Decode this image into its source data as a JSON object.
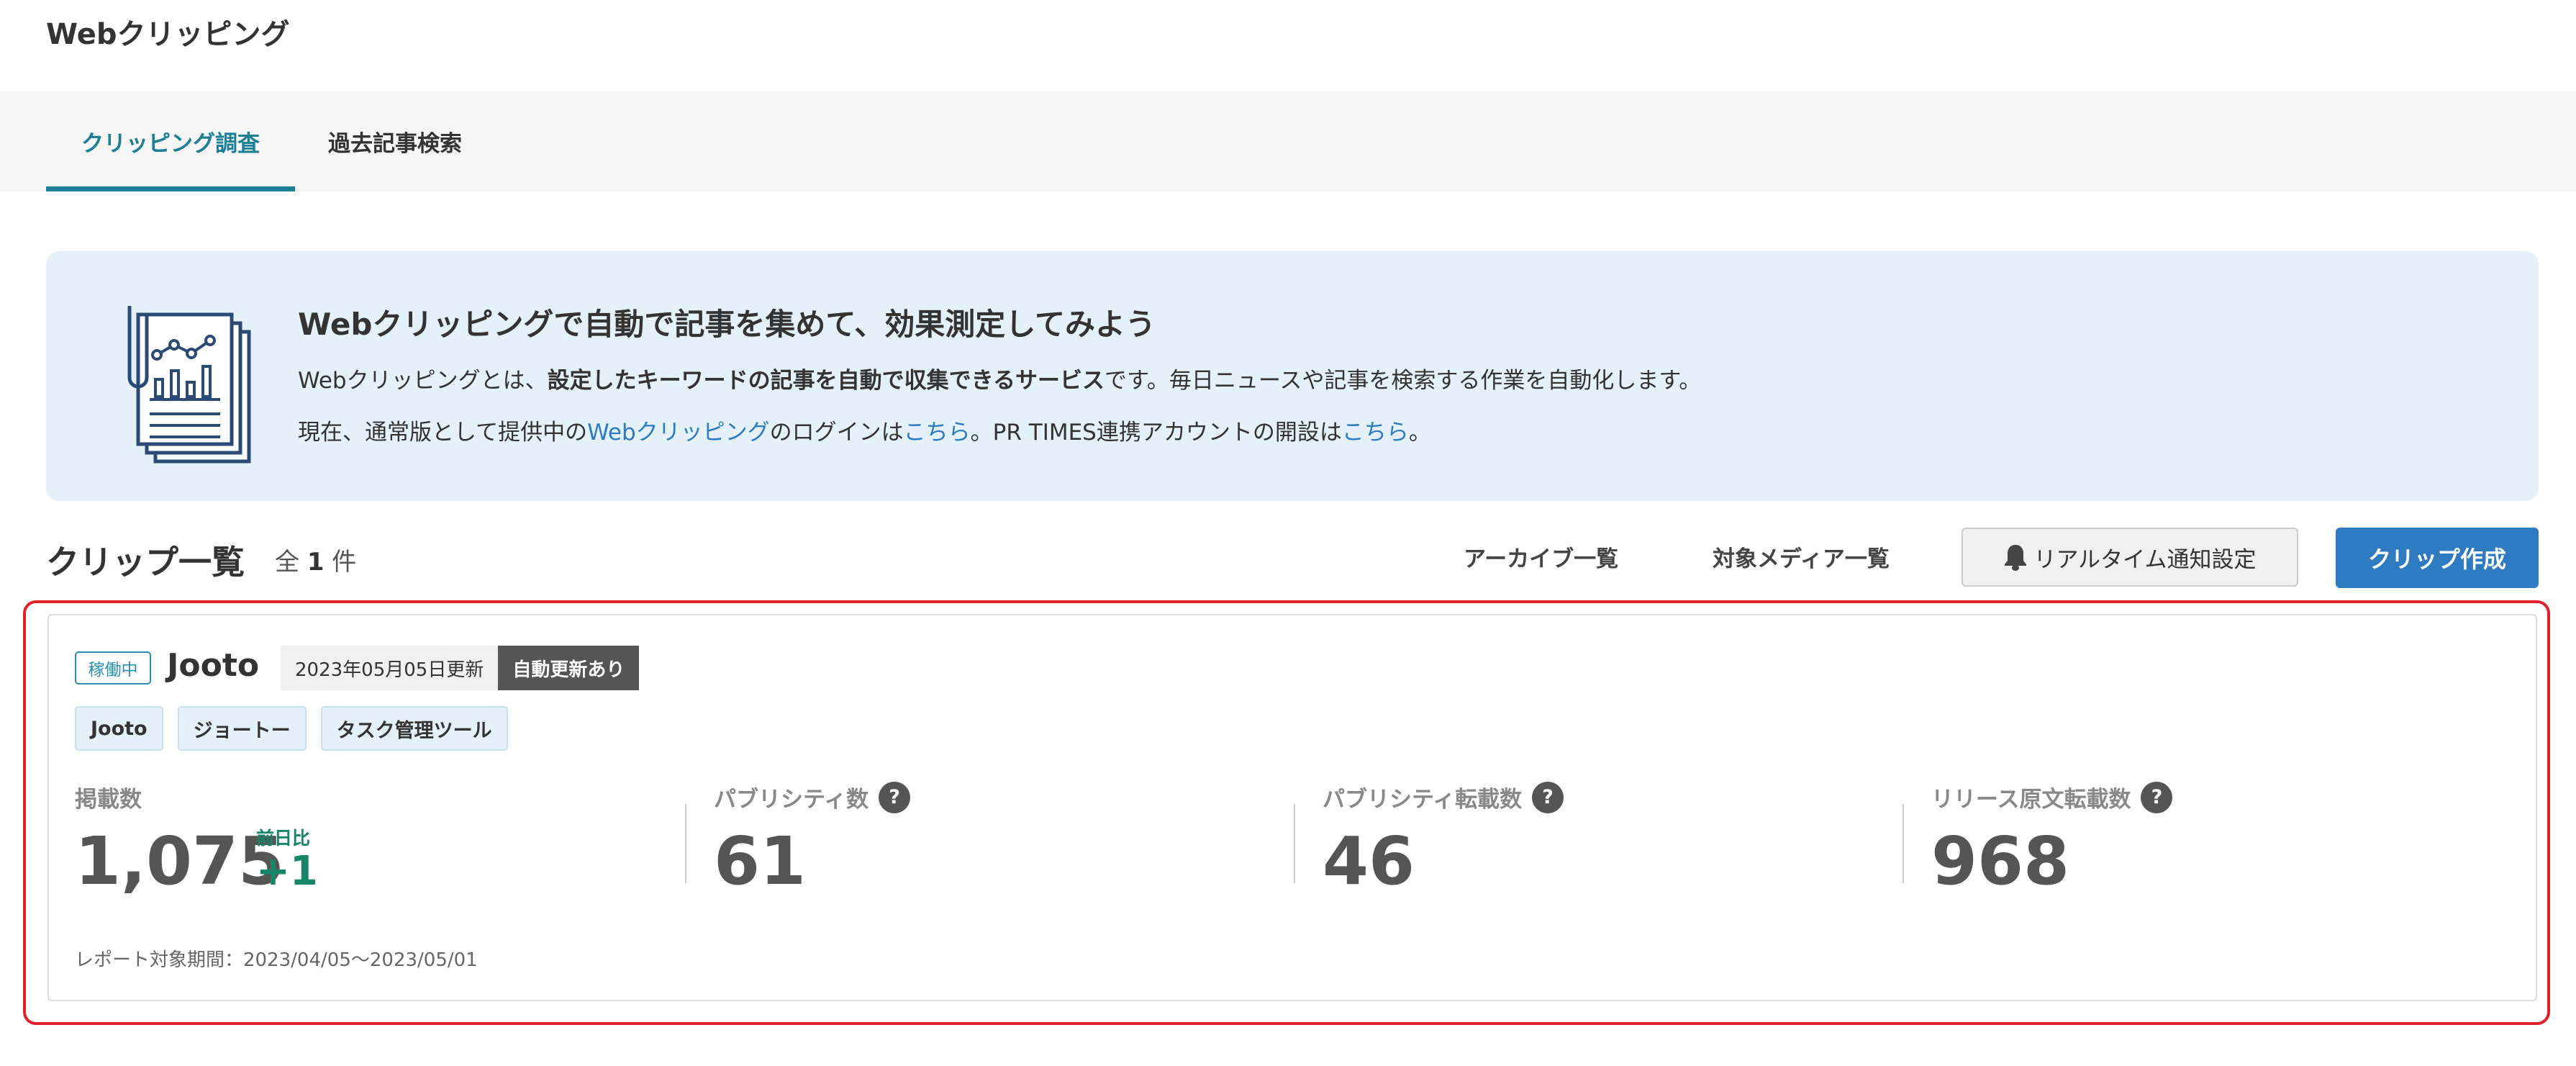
{
  "app": {
    "title": "Webクリッピング"
  },
  "tabs": [
    {
      "label": "クリッピング調査",
      "active": true
    },
    {
      "label": "過去記事検索",
      "active": false
    }
  ],
  "banner": {
    "title": "Webクリッピングで自動で記事を集めて、効果測定してみよう",
    "line1_prefix": "Webクリッピングとは、",
    "line1_bold": "設定したキーワードの記事を自動で収集できるサービス",
    "line1_suffix": "です。毎日ニュースや記事を検索する作業を自動化します。",
    "line2_a": "現在、通常版として提供中の",
    "line2_link1": "Webクリッピング",
    "line2_b": "のログインは",
    "line2_link2": "こちら",
    "line2_c": "。PR TIMES連携アカウントの開設は",
    "line2_link3": "こちら",
    "line2_d": "。"
  },
  "list": {
    "title": "クリップ一覧",
    "count_prefix": "全",
    "count": "1",
    "count_suffix": "件",
    "archive_label": "アーカイブ一覧",
    "media_label": "対象メディア一覧",
    "notify_label": "リアルタイム通知設定",
    "notify_icon": "bell-icon",
    "create_label": "クリップ作成"
  },
  "clip": {
    "status": "稼働中",
    "name": "Jooto",
    "updated": "2023年05月05日更新",
    "auto_update": "自動更新あり",
    "keywords": [
      "Jooto",
      "ジョートー",
      "タスク管理ツール"
    ],
    "metrics": {
      "published": {
        "label": "掲載数",
        "value": "1,075",
        "change_label": "前日比",
        "change_value": "+1"
      },
      "publicity": {
        "label": "パブリシティ数",
        "value": "61"
      },
      "publicity_repost": {
        "label": "パブリシティ転載数",
        "value": "46"
      },
      "release_repost": {
        "label": "リリース原文転載数",
        "value": "968"
      }
    },
    "help_glyph": "?",
    "report_period": "レポート対象期間：2023/04/05〜2023/05/01"
  },
  "colors": {
    "accent": "#1b7f95",
    "primary_button": "#2e7bc2",
    "banner_bg": "#e5f1f9",
    "highlight": "#e0202a",
    "positive": "#17856a"
  }
}
